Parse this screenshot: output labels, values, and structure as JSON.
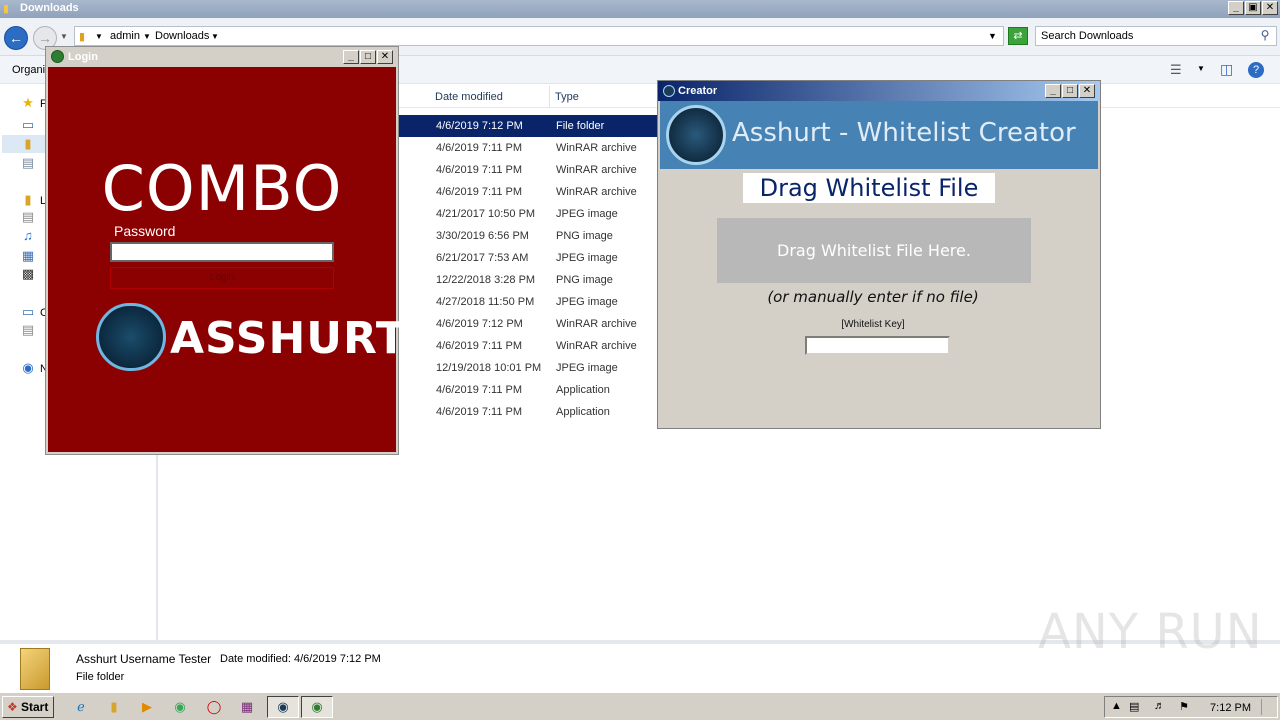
{
  "explorer": {
    "title": "Downloads",
    "breadcrumb": [
      "admin",
      "Downloads"
    ],
    "search_placeholder": "Search Downloads",
    "toolbar": {
      "organize_label": "Organi"
    },
    "nav_letters": [
      "F",
      "L",
      "C",
      "N"
    ],
    "columns": {
      "date_modified": "Date modified",
      "type": "Type"
    },
    "rows": [
      {
        "date": "4/6/2019 7:12 PM",
        "type": "File folder",
        "selected": true
      },
      {
        "date": "4/6/2019 7:11 PM",
        "type": "WinRAR archive"
      },
      {
        "date": "4/6/2019 7:11 PM",
        "type": "WinRAR archive"
      },
      {
        "date": "4/6/2019 7:11 PM",
        "type": "WinRAR archive"
      },
      {
        "date": "4/21/2017 10:50 PM",
        "type": "JPEG image"
      },
      {
        "date": "3/30/2019 6:56 PM",
        "type": "PNG image"
      },
      {
        "date": "6/21/2017 7:53 AM",
        "type": "JPEG image"
      },
      {
        "date": "12/22/2018 3:28 PM",
        "type": "PNG image"
      },
      {
        "date": "4/27/2018 11:50 PM",
        "type": "JPEG image"
      },
      {
        "date": "4/6/2019 7:12 PM",
        "type": "WinRAR archive"
      },
      {
        "date": "4/6/2019 7:11 PM",
        "type": "WinRAR archive"
      },
      {
        "date": "12/19/2018 10:01 PM",
        "type": "JPEG image"
      },
      {
        "date": "4/6/2019 7:11 PM",
        "type": "Application"
      },
      {
        "date": "4/6/2019 7:11 PM",
        "type": "Application"
      }
    ],
    "details": {
      "name": "Asshurt Username Tester",
      "meta": "Date modified: 4/6/2019 7:12 PM",
      "type": "File folder"
    }
  },
  "login_window": {
    "title": "Login",
    "heading": "COMBO",
    "password_label": "Password",
    "login_button": "Login",
    "logo_text": "ASSHURT"
  },
  "creator_window": {
    "title": "Creator",
    "heading": "Asshurt - Whitelist Creator",
    "drag_title": "Drag Whitelist File",
    "drop_zone": "Drag Whitelist File Here.",
    "manual_note": "(or manually enter if no file)",
    "key_label": "[Whitelist Key]"
  },
  "taskbar": {
    "start_label": "Start",
    "clock": "7:12 PM"
  },
  "watermark": "ANY RUN",
  "colors": {
    "login_bg": "#8b0000",
    "creator_header": "#4682b4",
    "selection": "#0a246a"
  }
}
